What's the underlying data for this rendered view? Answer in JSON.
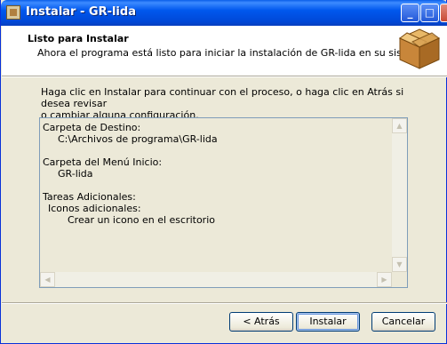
{
  "window": {
    "title": "Instalar - GR-lida"
  },
  "titlebar_buttons": {
    "minimize": "_",
    "maximize": "□",
    "close": "✕"
  },
  "header": {
    "title": "Listo para Instalar",
    "subtitle": "Ahora el programa está listo para iniciar la instalación de GR-lida en su sistema.",
    "icon": "package-box-icon"
  },
  "main": {
    "intro_line1": "Haga clic en Instalar para continuar con el proceso, o haga clic en Atrás si desea revisar",
    "intro_line2": "o cambiar alguna configuración.",
    "summary": {
      "dest_label": "Carpeta de Destino:",
      "dest_value": "C:\\Archivos de programa\\GR-lida",
      "menu_label": "Carpeta del Menú Inicio:",
      "menu_value": "GR-lida",
      "tasks_label": "Tareas Adicionales:",
      "tasks_group": "Iconos adicionales:",
      "tasks_item": "Crear un icono en el escritorio"
    }
  },
  "buttons": {
    "back": "< Atrás",
    "install": "Instalar",
    "cancel": "Cancelar"
  }
}
